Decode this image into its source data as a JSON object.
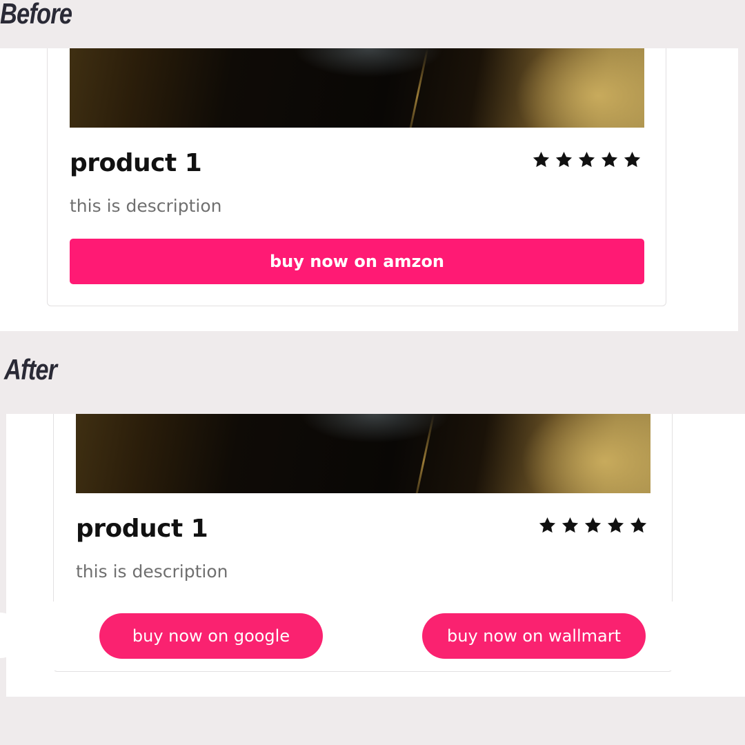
{
  "before": {
    "label": "Before",
    "product": {
      "title": "product 1",
      "rating": 5,
      "description": "this is description",
      "button_label": "buy now on amzon"
    }
  },
  "after": {
    "label": "After",
    "product": {
      "title": "product 1",
      "rating": 5,
      "description": "this is description",
      "buttons": [
        {
          "label": "buy now on google"
        },
        {
          "label": "buy now on wallmart"
        }
      ]
    }
  },
  "colors": {
    "accent": "#ff1a74",
    "background": "#efebec",
    "label_text": "#2a2a36"
  }
}
